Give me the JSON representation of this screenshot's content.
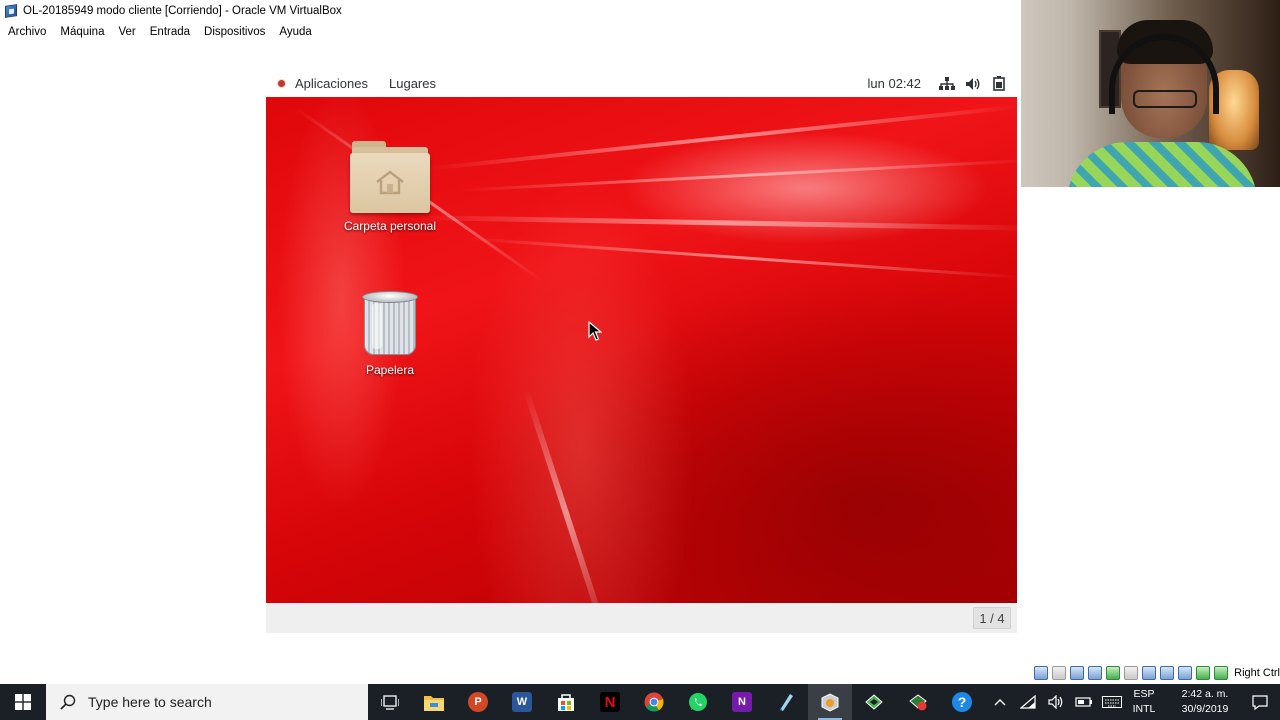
{
  "window": {
    "title": "OL-20185949 modo cliente [Corriendo] - Oracle VM VirtualBox"
  },
  "menubar": {
    "items": [
      "Archivo",
      "Máquina",
      "Ver",
      "Entrada",
      "Dispositivos",
      "Ayuda"
    ]
  },
  "guest": {
    "panel": {
      "applications": "Aplicaciones",
      "places": "Lugares",
      "clock": "lun 02:42"
    },
    "desktop_icons": [
      {
        "label": "Carpeta personal",
        "icon": "home-folder-icon"
      },
      {
        "label": "Papelera",
        "icon": "trash-icon"
      }
    ],
    "workspace_indicator": "1 / 4"
  },
  "vbox_status": {
    "host_key": "Right Ctrl"
  },
  "taskbar": {
    "search_placeholder": "Type here to search",
    "language_line1": "ESP",
    "language_line2": "INTL",
    "time": "2:42 a. m.",
    "date": "30/9/2019",
    "apps": [
      "task-view-icon",
      "file-explorer-icon",
      "powerpoint-icon",
      "word-icon",
      "store-icon",
      "netflix-icon",
      "chrome-icon",
      "whatsapp-icon",
      "onenote-icon",
      "app-icon",
      "virtualbox-icon",
      "app-icon",
      "app-icon",
      "help-icon"
    ]
  },
  "colors": {
    "taskbar_bg": "#1b2027",
    "wallpaper_red": "#e0070b",
    "search_bg": "#f2f2f2"
  }
}
